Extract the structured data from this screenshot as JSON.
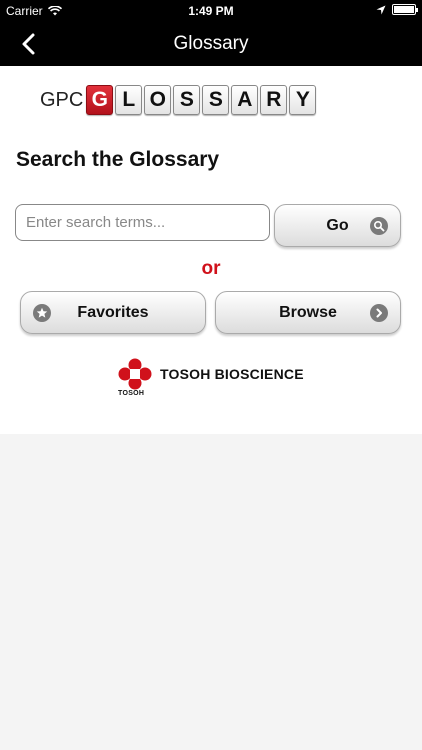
{
  "status_bar": {
    "carrier": "Carrier",
    "time": "1:49 PM"
  },
  "nav": {
    "title": "Glossary"
  },
  "logo": {
    "prefix": "GPC",
    "letters": [
      "G",
      "L",
      "O",
      "S",
      "S",
      "A",
      "R",
      "Y"
    ]
  },
  "search": {
    "heading": "Search the Glossary",
    "placeholder": "Enter search terms...",
    "go_label": "Go"
  },
  "or_label": "or",
  "buttons": {
    "favorites_label": "Favorites",
    "browse_label": "Browse"
  },
  "brand": {
    "name": "TOSOH BIOSCIENCE",
    "mark_text": "TOSOH"
  },
  "colors": {
    "accent_red": "#d0111b",
    "nav_bg": "#000000"
  }
}
